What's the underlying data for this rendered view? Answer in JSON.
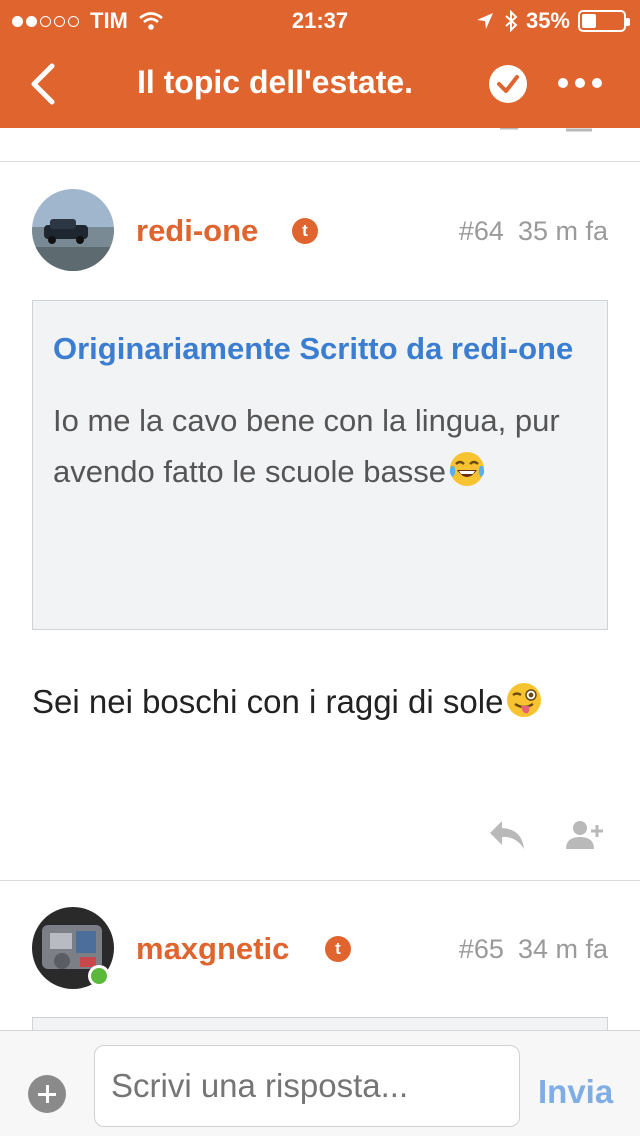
{
  "status_bar": {
    "carrier": "TIM",
    "time": "21:37",
    "battery": "35%",
    "battery_level": 0.35,
    "signal_bars_filled": 2,
    "icons": [
      "wifi-icon",
      "location-arrow-icon",
      "bluetooth-icon",
      "battery-icon"
    ]
  },
  "nav": {
    "title": "Il topic dell'estate.",
    "back_icon": "chevron-left-icon",
    "verified_icon": "check-circle-icon",
    "more_icon": "ellipsis-icon"
  },
  "posts": [
    {
      "username": "redi-one",
      "badge": "t",
      "number": "#64",
      "time": "35 m fa",
      "quote_header": "Originariamente Scritto da redi-one",
      "quote_text": "Io me la cavo bene con la lingua, pur avendo fatto le scuole basse",
      "quote_emoji": "tears-of-joy-emoji",
      "body": "Sei nei boschi con i raggi di sole",
      "body_emoji": "winking-tongue-emoji",
      "actions": [
        "reply-icon",
        "add-user-icon"
      ]
    },
    {
      "username": "maxgnetic",
      "badge": "t",
      "number": "#65",
      "time": "34 m fa",
      "online": true
    }
  ],
  "reply_bar": {
    "placeholder": "Scrivi una risposta...",
    "send_label": "Invia"
  },
  "colors": {
    "brand": "#e0642e",
    "link": "#3b7dd0",
    "send_disabled": "#7faee6",
    "online": "#5cb83a"
  }
}
